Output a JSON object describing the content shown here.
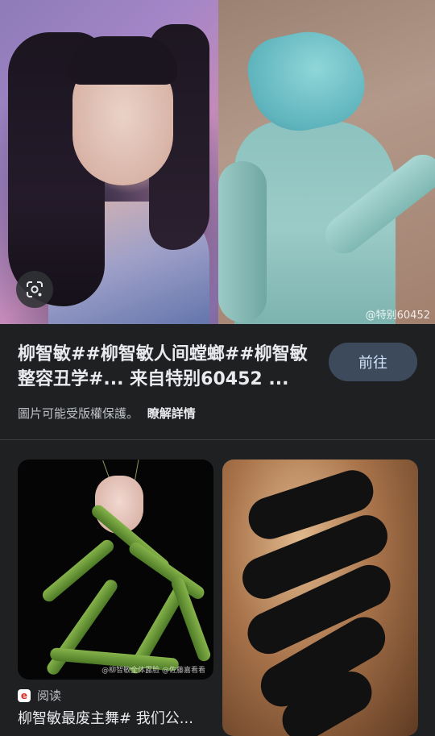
{
  "hero": {
    "watermark": "@特别60452",
    "lens_icon": "google-lens-icon"
  },
  "result": {
    "title": "柳智敏##柳智敏人间螳螂##柳智敏整容丑学#... 来自特别60452 ...",
    "visit_label": "前往",
    "copyright_notice": "圖片可能受版權保護。",
    "learn_more": "瞭解詳情"
  },
  "related": [
    {
      "source_name": "阅读",
      "source_icon": "e-reader-icon",
      "source_icon_letter": "e",
      "title": "柳智敏最废主舞# 我们公...",
      "watermark": "@柳智敏全体露脸 @佐藤嘉看看"
    },
    {
      "source_name": "",
      "title": ""
    }
  ],
  "colors": {
    "background": "#1f2022",
    "button_bg": "#3c4a5c",
    "button_text": "#d3e3fd"
  }
}
